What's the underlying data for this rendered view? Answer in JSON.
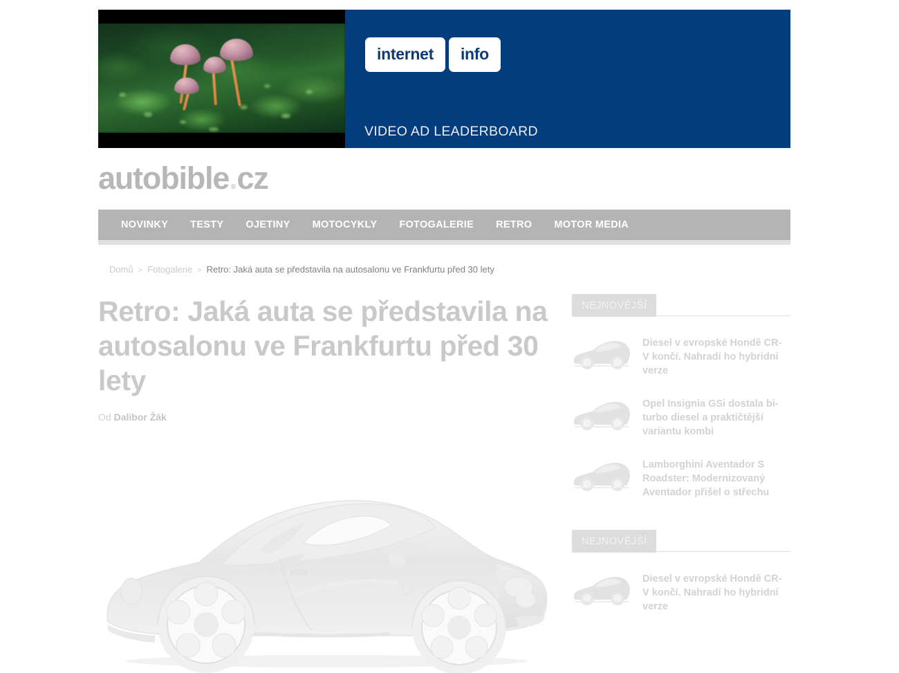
{
  "ad": {
    "logo_part1": "internet",
    "logo_part2": "info",
    "caption": "VIDEO AD LEADERBOARD",
    "brand_blue": "#043d7d",
    "video_scene": "mushrooms-on-clover"
  },
  "site": {
    "logo_main": "autobible",
    "logo_dot": ".",
    "logo_tld": "cz"
  },
  "nav": {
    "items": [
      {
        "label": "NOVINKY"
      },
      {
        "label": "TESTY"
      },
      {
        "label": "OJETINY"
      },
      {
        "label": "MOTOCYKLY"
      },
      {
        "label": "FOTOGALERIE"
      },
      {
        "label": "RETRO"
      },
      {
        "label": "MOTOR MEDIA"
      }
    ]
  },
  "breadcrumb": {
    "home": "Domů",
    "sep1": ">",
    "section": "Fotogalerie",
    "sep2": ">",
    "current": "Retro: Jaká auta se představila na autosalonu ve Frankfurtu před 30 lety"
  },
  "article": {
    "title": "Retro: Jaká auta se představila na autosalonu ve Frankfurtu před 30 lety",
    "byline_prefix": "Od",
    "byline_author": "Dalibor Žák",
    "hero_image_alt": "silver sports car side profile"
  },
  "sidebar": {
    "blocks": [
      {
        "heading": "NEJNOVĚJŠÍ",
        "items": [
          {
            "title": "Diesel v evropské Hondě CR-V končí. Nahradí ho hybridní verze"
          },
          {
            "title": "Opel Insignia GSi dostala bi-turbo diesel a praktičtější variantu kombi"
          },
          {
            "title": "Lamborghini Aventador S Roadster: Modernizovaný Aventador přišel o střechu"
          }
        ]
      },
      {
        "heading": "NEJNOVĚJŠÍ",
        "items": [
          {
            "title": "Diesel v evropské Hondě CR-V končí. Nahradí ho hybridní verze"
          }
        ]
      }
    ]
  },
  "colors": {
    "nav_bg": "#b4b4b4",
    "nav_underline": "#e0e0e0",
    "badge_bg": "#dcdcdc",
    "text_muted": "#c9c9c9"
  }
}
